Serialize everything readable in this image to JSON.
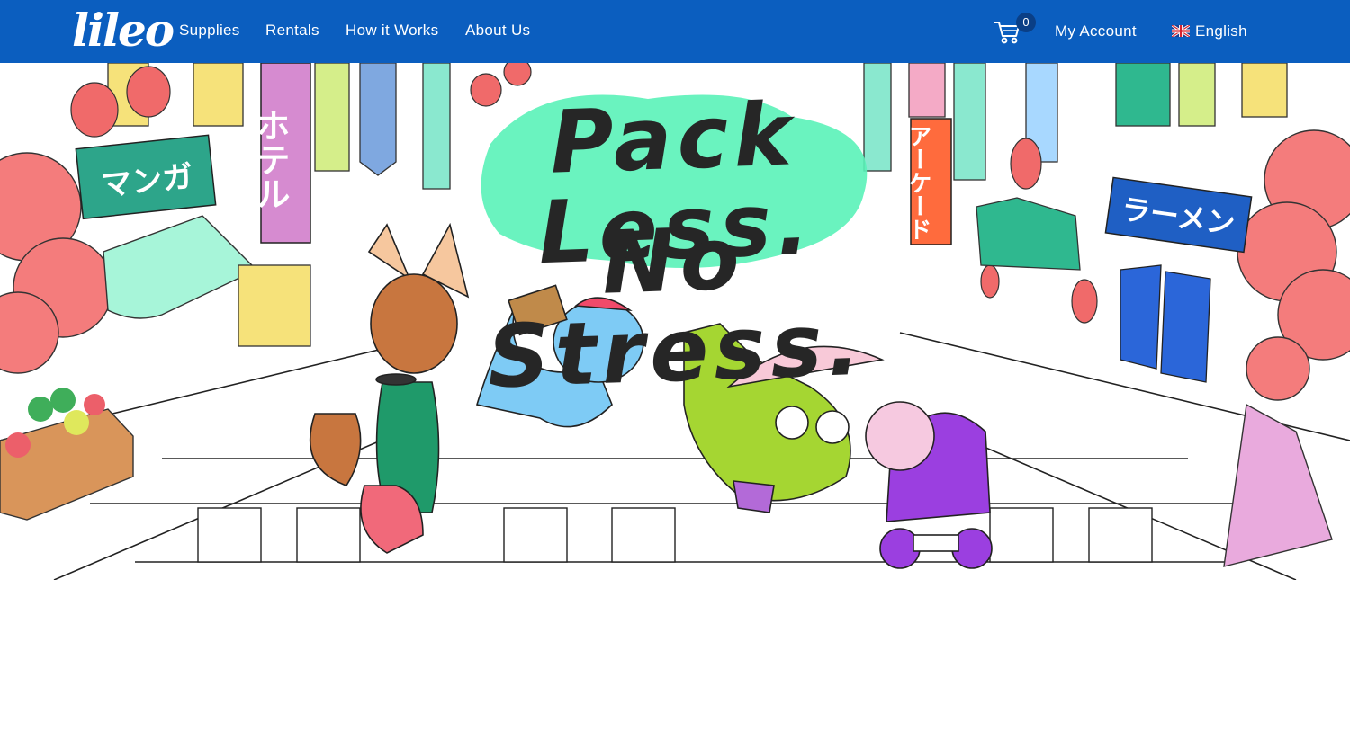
{
  "brand": {
    "logo_text": "lileo"
  },
  "nav": {
    "items": [
      {
        "label": "Supplies"
      },
      {
        "label": "Rentals"
      },
      {
        "label": "How it Works"
      },
      {
        "label": "About Us"
      }
    ],
    "cart_count": "0",
    "account_label": "My Account",
    "language_label": "English"
  },
  "hero": {
    "headline_line1": "Pack Less.",
    "headline_line2": "No Stress.",
    "signs": {
      "manga": "マンガ",
      "hotel": "ホテル",
      "arcade": "アーケード",
      "ramen": "ラーメン"
    }
  },
  "colors": {
    "nav_bg": "#0b5ebf",
    "highlight": "#5af2b8",
    "headline": "#262626"
  },
  "icons": [
    "cart-icon",
    "uk-flag-icon"
  ]
}
